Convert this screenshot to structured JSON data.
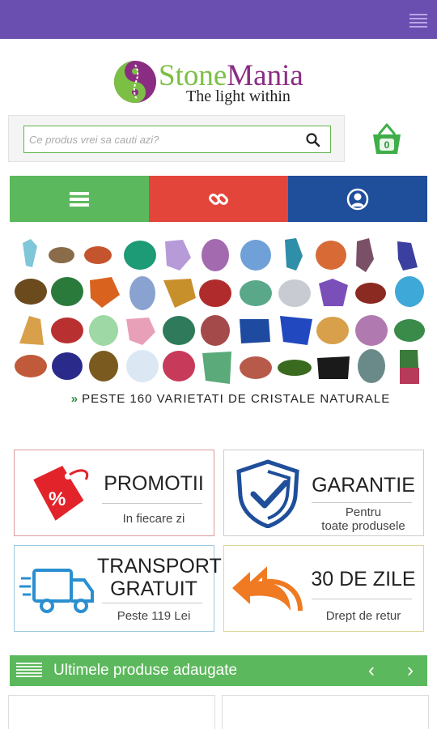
{
  "header": {
    "menu_icon": "hamburger-icon"
  },
  "logo": {
    "brand_part1": "Stone",
    "brand_part2": "Mania",
    "tagline": "The light within"
  },
  "search": {
    "placeholder": "Ce produs vrei sa cauti azi?",
    "icon": "search-icon"
  },
  "cart": {
    "icon": "basket-icon",
    "count": "0"
  },
  "nav": [
    {
      "icon": "list-icon",
      "color": "#5cb85c"
    },
    {
      "icon": "link-icon",
      "color": "#e3453a"
    },
    {
      "icon": "user-icon",
      "color": "#1f4e9a"
    }
  ],
  "gems": {
    "caption": "PESTE 160 VARIETATI DE CRISTALE NATURALE",
    "bullet": "»"
  },
  "features": [
    {
      "title": "PROMOTII",
      "subtitle": "In fiecare zi",
      "icon": "price-tag-icon"
    },
    {
      "title": "GARANTIE",
      "subtitle_line1": "Pentru",
      "subtitle_line2": "toate produsele",
      "icon": "shield-check-icon"
    },
    {
      "title_line1": "TRANSPORT",
      "title_line2": "GRATUIT",
      "subtitle": "Peste 119 Lei",
      "icon": "delivery-truck-icon"
    },
    {
      "title": "30 DE ZILE",
      "subtitle": "Drept de retur",
      "icon": "return-arrow-icon"
    }
  ],
  "latest_products": {
    "label": "Ultimele produse adaugate",
    "prev": "‹",
    "next": "›"
  },
  "colors": {
    "topbar": "#6b4fb0",
    "green": "#5cb85c",
    "red": "#e3453a",
    "blue": "#1f4e9a",
    "brand_green": "#7cbf45",
    "brand_purple": "#8a2d82"
  }
}
